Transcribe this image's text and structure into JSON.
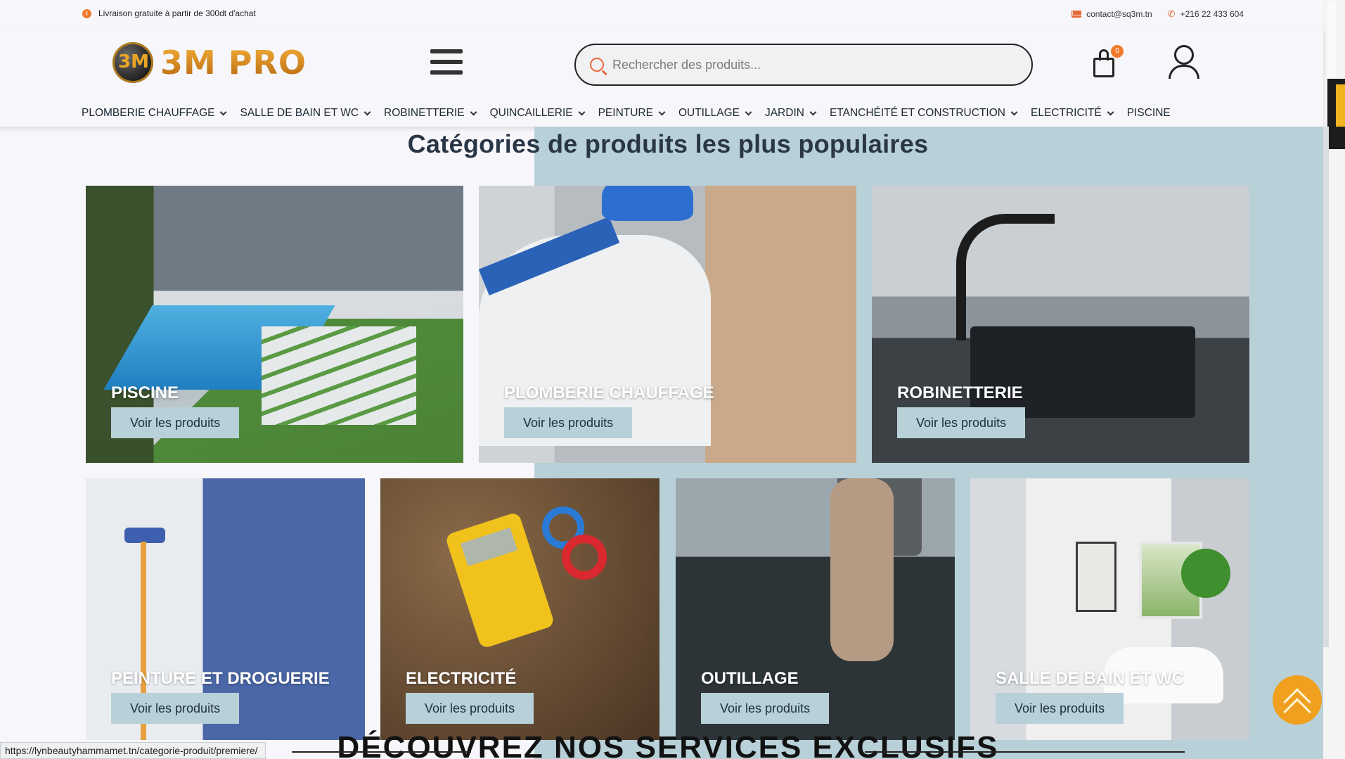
{
  "topbar": {
    "shipping_note": "Livraison gratuite à partir de 300dt d'achat",
    "email": "contact@sq3m.tn",
    "phone": "+216 22 433 604"
  },
  "header": {
    "logo_text": "3M PRO",
    "logo_mark": "3M",
    "search_placeholder": "Rechercher des produits...",
    "cart_count": "0"
  },
  "nav": {
    "items": [
      {
        "label": "PLOMBERIE CHAUFFAGE",
        "has_dropdown": true
      },
      {
        "label": "SALLE DE BAIN ET WC",
        "has_dropdown": true
      },
      {
        "label": "ROBINETTERIE",
        "has_dropdown": true
      },
      {
        "label": "QUINCAILLERIE",
        "has_dropdown": true
      },
      {
        "label": "PEINTURE",
        "has_dropdown": true
      },
      {
        "label": "OUTILLAGE",
        "has_dropdown": true
      },
      {
        "label": "JARDIN",
        "has_dropdown": true
      },
      {
        "label": "ETANCHÉITÉ ET CONSTRUCTION",
        "has_dropdown": true
      },
      {
        "label": "ELECTRICITÉ",
        "has_dropdown": true
      },
      {
        "label": "PISCINE",
        "has_dropdown": false
      }
    ]
  },
  "main": {
    "section_title": "Catégories de produits les plus populaires",
    "button_label": "Voir les produits",
    "categories": [
      {
        "title": "PISCINE"
      },
      {
        "title": "PLOMBERIE CHAUFFAGE"
      },
      {
        "title": "ROBINETTERIE"
      },
      {
        "title": "PEINTURE ET DROGUERIE"
      },
      {
        "title": "ELECTRICITÉ"
      },
      {
        "title": "OUTILLAGE"
      },
      {
        "title": "SALLE DE BAIN ET WC"
      }
    ],
    "below_title": "DÉCOUVREZ NOS SERVICES EXCLUSIFS"
  },
  "status_bar": {
    "url": "https://lynbeautyhammamet.tn/categorie-produit/premiere/"
  },
  "colors": {
    "accent": "#f07a2a",
    "button_bg": "#b8d0d8",
    "scroll_top": "#f0a01e"
  }
}
